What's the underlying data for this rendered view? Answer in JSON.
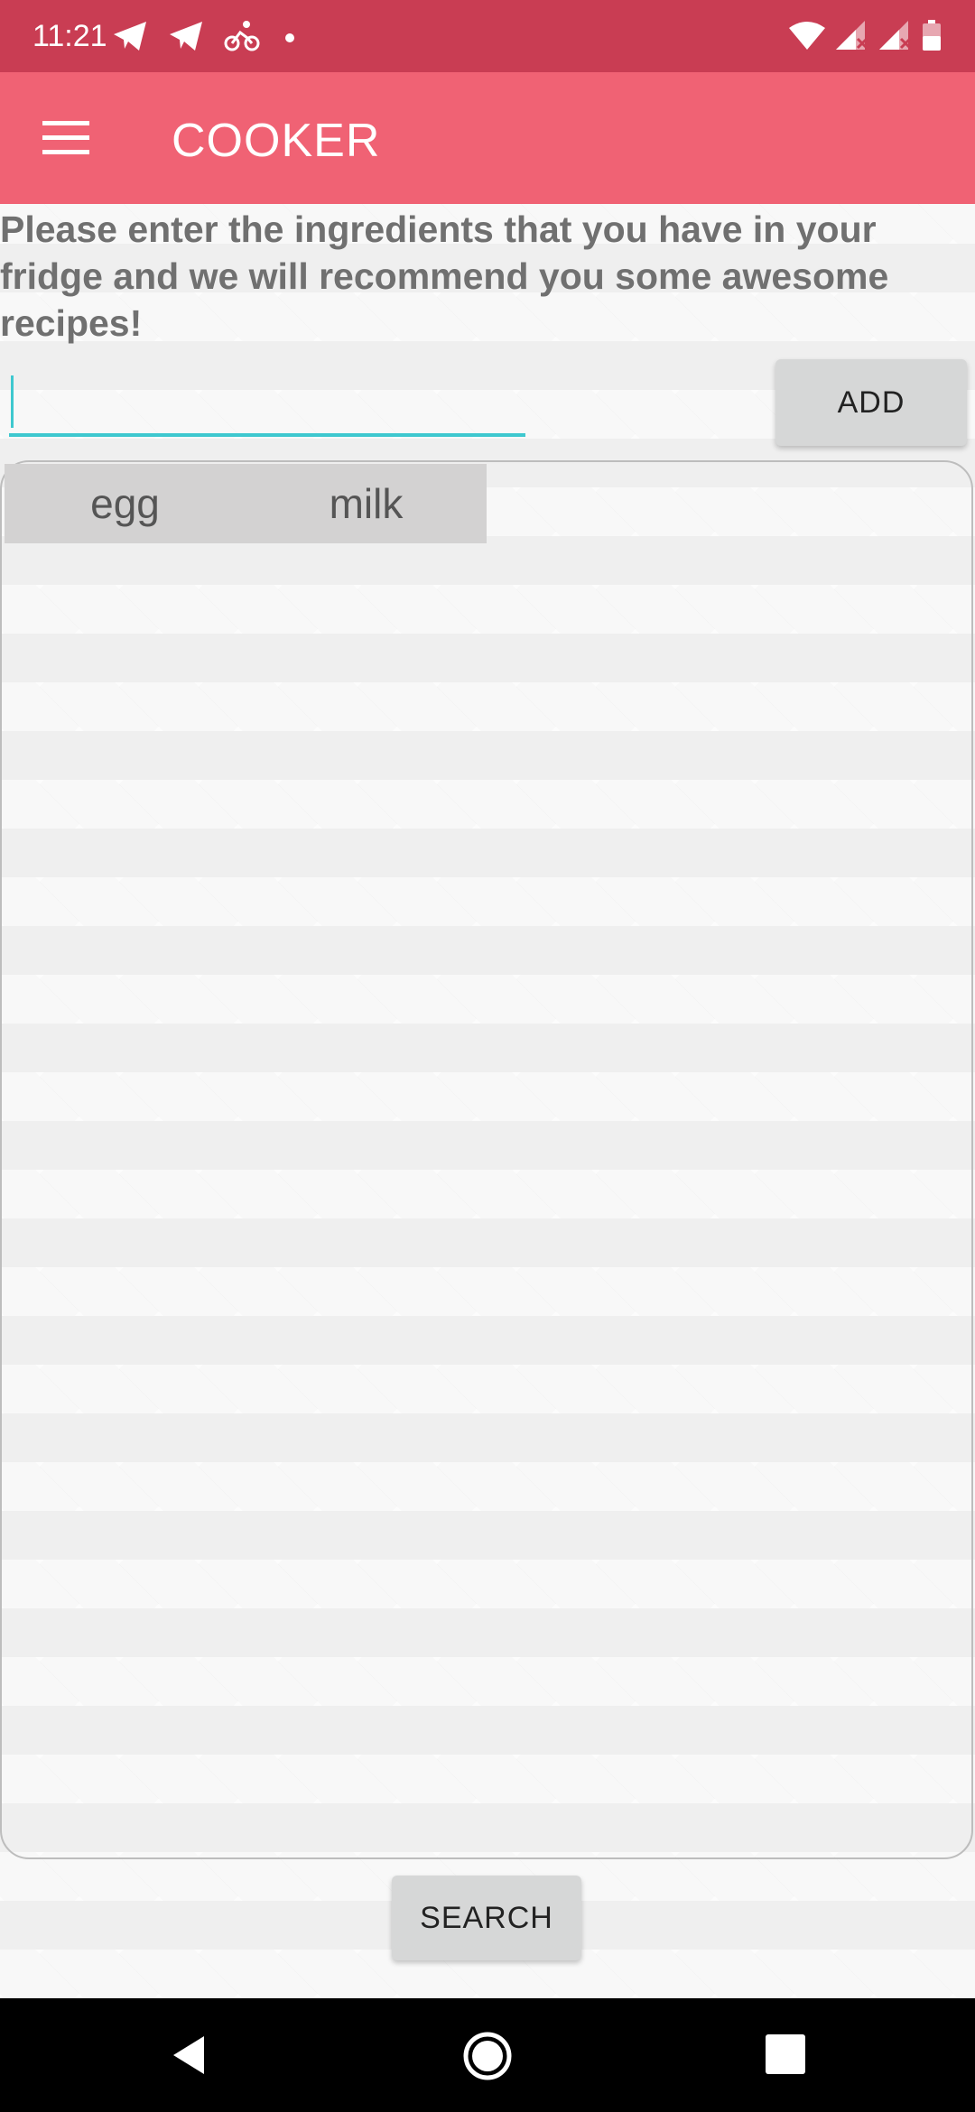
{
  "status_bar": {
    "time": "11:21",
    "left_icons": [
      "telegram-icon",
      "telegram-icon",
      "cycling-icon",
      "notification-dot-icon"
    ],
    "right_icons": [
      "wifi-icon",
      "signal-no-data-icon",
      "signal-no-data-icon",
      "battery-icon"
    ],
    "background_color": "#c93d53"
  },
  "app_bar": {
    "menu_icon": "hamburger-menu-icon",
    "title": "COOKER",
    "background_color": "#f06274"
  },
  "main": {
    "instructions": "Please enter the ingredients that you have in your fridge and we will recommend you some awesome recipes!",
    "ingredient_input": {
      "value": "",
      "placeholder": ""
    },
    "add_button_label": "ADD",
    "ingredients": [
      "egg",
      "milk"
    ],
    "search_button_label": "SEARCH",
    "accent_color": "#3ec8cf"
  },
  "nav_bar": {
    "icons": [
      "back-icon",
      "home-icon",
      "recents-icon"
    ]
  }
}
